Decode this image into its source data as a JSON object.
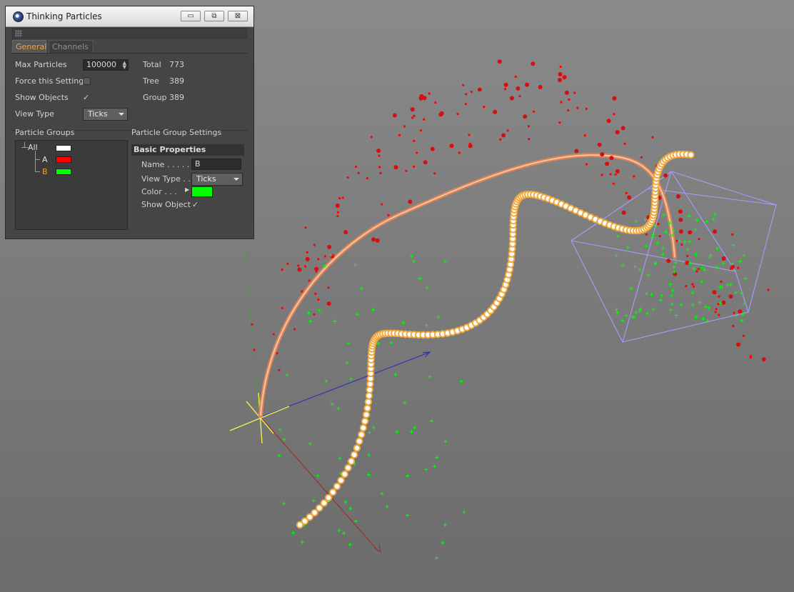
{
  "window": {
    "title": "Thinking Particles",
    "controls": {
      "minimize": "▭",
      "maximize": "⧉",
      "close": "⊠"
    }
  },
  "tabs": [
    {
      "label": "General",
      "active": true
    },
    {
      "label": "Channels",
      "active": false
    }
  ],
  "general": {
    "max_particles_label": "Max Particles",
    "max_particles_value": "100000",
    "force_setting_label": "Force this Setting",
    "show_objects_label": "Show Objects",
    "view_type_label": "View Type",
    "view_type_value": "Ticks",
    "total_label": "Total",
    "total_value": "773",
    "tree_label": "Tree",
    "tree_value": "389",
    "group_label": "Group",
    "group_value": "389"
  },
  "particle_groups": {
    "label": "Particle Groups",
    "items": [
      {
        "name": "All",
        "color": "#ffffff"
      },
      {
        "name": "A",
        "color": "#ff0000"
      },
      {
        "name": "B",
        "color": "#00ff00",
        "selected": true
      }
    ]
  },
  "group_settings": {
    "label": "Particle Group Settings",
    "section": "Basic Properties",
    "name_label": "Name . . . . . .",
    "name_value": "B",
    "view_type_label": "View Type . .",
    "view_type_value": "Ticks",
    "color_label": "Color . . .",
    "color_value": "#00ff00",
    "show_object_label": "Show Object"
  },
  "colors": {
    "accent_tab": "#f0a332",
    "group_a": "#ff0000",
    "group_b": "#00ff00",
    "path_stroke": "#f2a872",
    "cage": "#a79bff"
  }
}
